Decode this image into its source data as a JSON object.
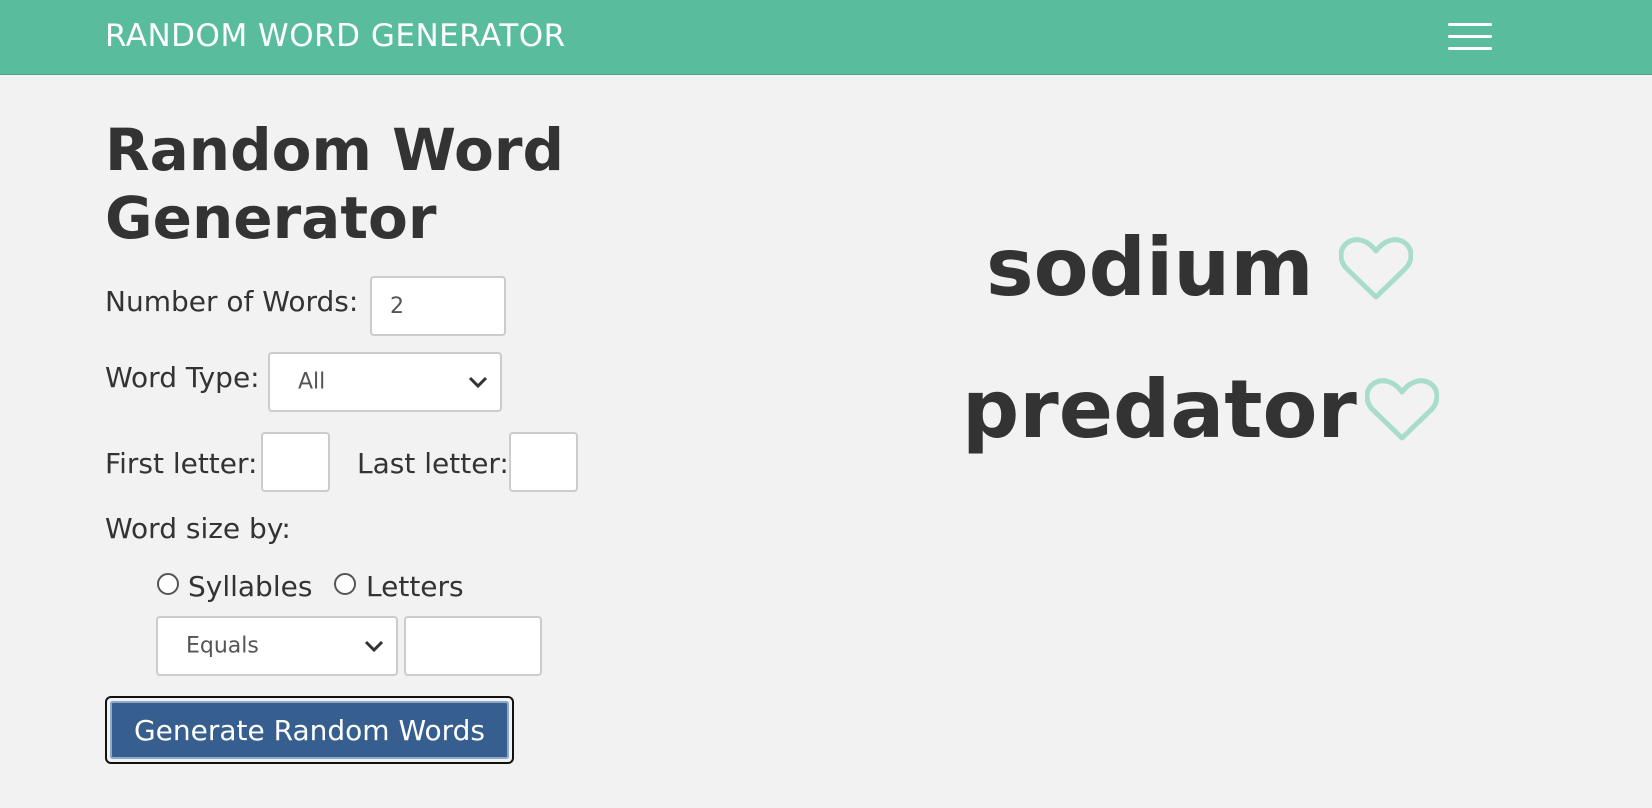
{
  "header": {
    "brand": "RANDOM WORD GENERATOR",
    "menu_icon": "hamburger-menu-icon"
  },
  "main": {
    "title": "Random Word Generator",
    "number_of_words": {
      "label": "Number of Words:",
      "value": "2"
    },
    "word_type": {
      "label": "Word Type:",
      "selected": "All"
    },
    "first_letter": {
      "label": "First letter:",
      "value": ""
    },
    "last_letter": {
      "label": "Last letter:",
      "value": ""
    },
    "word_size": {
      "label": "Word size by:",
      "options": [
        "Syllables",
        "Letters"
      ],
      "comparison_selected": "Equals",
      "size_value": ""
    },
    "generate_button": "Generate Random Words"
  },
  "results": {
    "words": [
      "sodium",
      "predator"
    ],
    "favorite_icon": "heart-outline-icon",
    "heart_color": "#a8dccb"
  },
  "colors": {
    "navbar": "#58bc9d",
    "button": "#365f8f",
    "background": "#f2f2f2",
    "text": "#333333"
  }
}
